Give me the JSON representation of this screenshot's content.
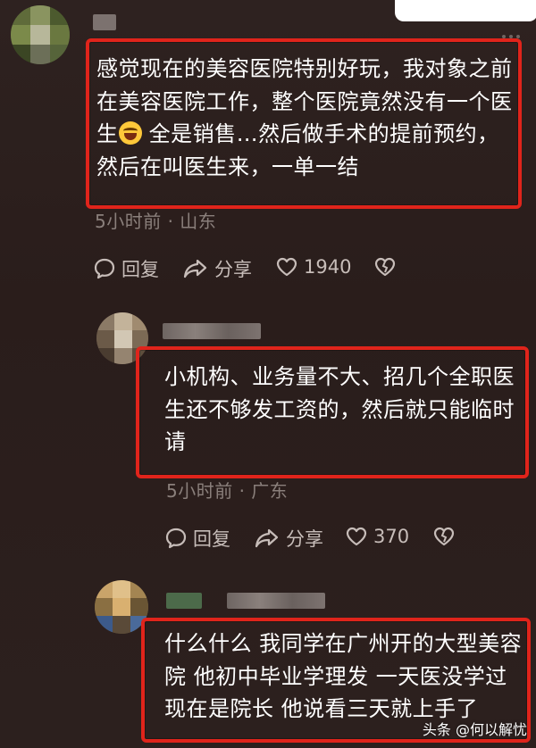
{
  "top_popup": {
    "text": ""
  },
  "comments": [
    {
      "text": "感觉现在的美容医院特别好玩，我对象之前在美容医院工作，整个医院竟然没有一个医生",
      "text_after_emoji": " 全是销售…然后做手术的提前预约，然后在叫医生来，一单一结",
      "meta": "5小时前 · 山东",
      "reply_label": "回复",
      "share_label": "分享",
      "like_count": "1940"
    },
    {
      "text": "小机构、业务量不大、招几个全职医生还不够发工资的，然后就只能临时请",
      "meta": "5小时前 · 广东",
      "reply_label": "回复",
      "share_label": "分享",
      "like_count": "370"
    },
    {
      "text": "什么什么 我同学在广州开的大型美容院 他初中毕业学理发 一天医没学过 现在是院长 他说看三天就上手了",
      "meta": ""
    }
  ],
  "watermark": {
    "text": "头条 @何以解忧"
  },
  "colors": {
    "highlight": "#e0241b",
    "background": "#2b1f1d",
    "meta": "#8a7f7b"
  }
}
